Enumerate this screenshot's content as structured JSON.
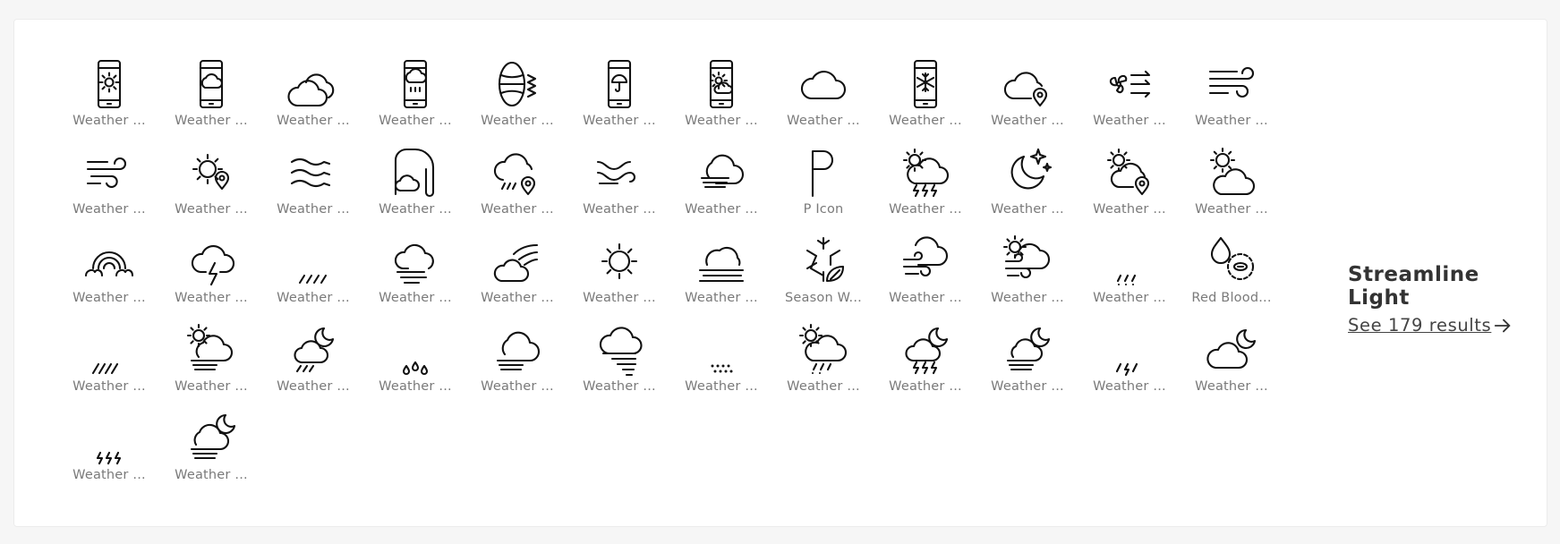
{
  "icons": [
    {
      "icon": "phone-sun-icon",
      "label": "Weather ..."
    },
    {
      "icon": "phone-cloud-icon",
      "label": "Weather ..."
    },
    {
      "icon": "double-cloud-icon",
      "label": "Weather ..."
    },
    {
      "icon": "phone-rain-icon",
      "label": "Weather ..."
    },
    {
      "icon": "wind-globe-icon",
      "label": "Weather ..."
    },
    {
      "icon": "phone-umbrella-icon",
      "label": "Weather ..."
    },
    {
      "icon": "phone-sun-cloud-icon",
      "label": "Weather ..."
    },
    {
      "icon": "cloud-icon",
      "label": "Weather ..."
    },
    {
      "icon": "phone-snowflake-icon",
      "label": "Weather ..."
    },
    {
      "icon": "cloud-location-icon",
      "label": "Weather ..."
    },
    {
      "icon": "fan-wind-icon",
      "label": "Weather ..."
    },
    {
      "icon": "wind-icon",
      "label": "Weather ..."
    },
    {
      "icon": "wind-swirl-icon",
      "label": "Weather ..."
    },
    {
      "icon": "sun-location-icon",
      "label": "Weather ..."
    },
    {
      "icon": "waves-wind-icon",
      "label": "Weather ..."
    },
    {
      "icon": "tornado-cloud-icon",
      "label": "Weather ..."
    },
    {
      "icon": "rain-cloud-location-icon",
      "label": "Weather ..."
    },
    {
      "icon": "wind-gust-icon",
      "label": "Weather ..."
    },
    {
      "icon": "cloud-haze-icon",
      "label": "Weather ..."
    },
    {
      "icon": "letter-p-icon",
      "label": "P Icon"
    },
    {
      "icon": "sun-thunderstorm-icon",
      "label": "Weather ..."
    },
    {
      "icon": "moon-star-icon",
      "label": "Weather ..."
    },
    {
      "icon": "sun-cloud-location-icon",
      "label": "Weather ..."
    },
    {
      "icon": "sun-cloud-icon",
      "label": "Weather ..."
    },
    {
      "icon": "rainbow-icon",
      "label": "Weather ..."
    },
    {
      "icon": "cloud-lightning-icon",
      "label": "Weather ..."
    },
    {
      "icon": "cloud-rain-icon",
      "label": "Weather ..."
    },
    {
      "icon": "cloud-fog-icon",
      "label": "Weather ..."
    },
    {
      "icon": "cloud-meteor-icon",
      "label": "Weather ..."
    },
    {
      "icon": "sun-icon",
      "label": "Weather ..."
    },
    {
      "icon": "cloud-mist-icon",
      "label": "Weather ..."
    },
    {
      "icon": "snowflake-leaf-icon",
      "label": "Season W..."
    },
    {
      "icon": "cloud-wind-icon",
      "label": "Weather ..."
    },
    {
      "icon": "sun-cloud-wind-icon",
      "label": "Weather ..."
    },
    {
      "icon": "cloud-sleet-icon",
      "label": "Weather ..."
    },
    {
      "icon": "blood-cell-drop-icon",
      "label": "Red Blood..."
    },
    {
      "icon": "cloud-heavy-rain-icon",
      "label": "Weather ..."
    },
    {
      "icon": "sun-cloud-fog-icon",
      "label": "Weather ..."
    },
    {
      "icon": "moon-cloud-rain-icon",
      "label": "Weather ..."
    },
    {
      "icon": "cloud-raindrops-icon",
      "label": "Weather ..."
    },
    {
      "icon": "cloud-haze-lines-icon",
      "label": "Weather ..."
    },
    {
      "icon": "cloud-tornado-icon",
      "label": "Weather ..."
    },
    {
      "icon": "cloud-hail-icon",
      "label": "Weather ..."
    },
    {
      "icon": "sun-cloud-rain-icon",
      "label": "Weather ..."
    },
    {
      "icon": "moon-cloud-storm-icon",
      "label": "Weather ..."
    },
    {
      "icon": "moon-cloud-fog-icon",
      "label": "Weather ..."
    },
    {
      "icon": "cloud-storm-rain-icon",
      "label": "Weather ..."
    },
    {
      "icon": "moon-cloud-icon",
      "label": "Weather ..."
    },
    {
      "icon": "cloud-thunder-icon",
      "label": "Weather ..."
    },
    {
      "icon": "moon-cloud-haze-icon",
      "label": "Weather ..."
    }
  ],
  "side": {
    "title": "Streamline Light",
    "link": "See 179 results",
    "arrow_icon": "arrow-right-icon"
  },
  "colors": {
    "icon_stroke": "#111111",
    "label": "#7a7a7a",
    "title": "#333333",
    "background": "#f6f6f6",
    "card": "#ffffff"
  }
}
